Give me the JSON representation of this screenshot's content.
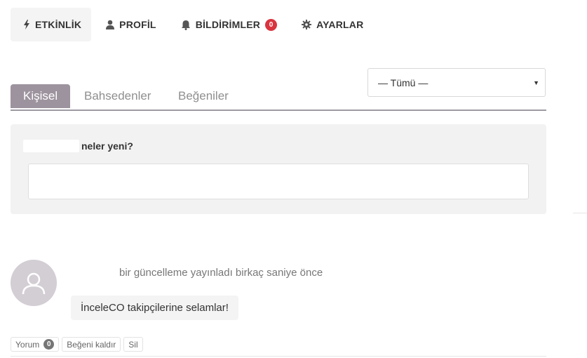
{
  "nav": {
    "items": [
      {
        "label": "ETKİNLİK",
        "icon": "bolt-icon",
        "active": true
      },
      {
        "label": "PROFİL",
        "icon": "user-icon"
      },
      {
        "label": "BİLDİRİMLER",
        "icon": "bell-icon",
        "badge": "0"
      },
      {
        "label": "AYARLAR",
        "icon": "gear-icon"
      }
    ]
  },
  "filter": {
    "selected": "— Tümü —"
  },
  "tabs": [
    {
      "label": "Kişisel",
      "active": true
    },
    {
      "label": "Bahsedenler"
    },
    {
      "label": "Beğeniler"
    }
  ],
  "post_form": {
    "prompt": "neler yeni?",
    "value": ""
  },
  "activity": {
    "meta": "bir güncelleme yayınladı birkaç saniye önce",
    "content": "İnceleCO takipçilerine selamlar!",
    "actions": {
      "comment_label": "Yorum",
      "comment_count": "0",
      "unlike_label": "Beğeni kaldır",
      "delete_label": "Sil"
    }
  },
  "colors": {
    "tab_active_bg": "#9d939e",
    "badge_red": "#d9343f",
    "avatar_bg": "#d3cdd4"
  }
}
